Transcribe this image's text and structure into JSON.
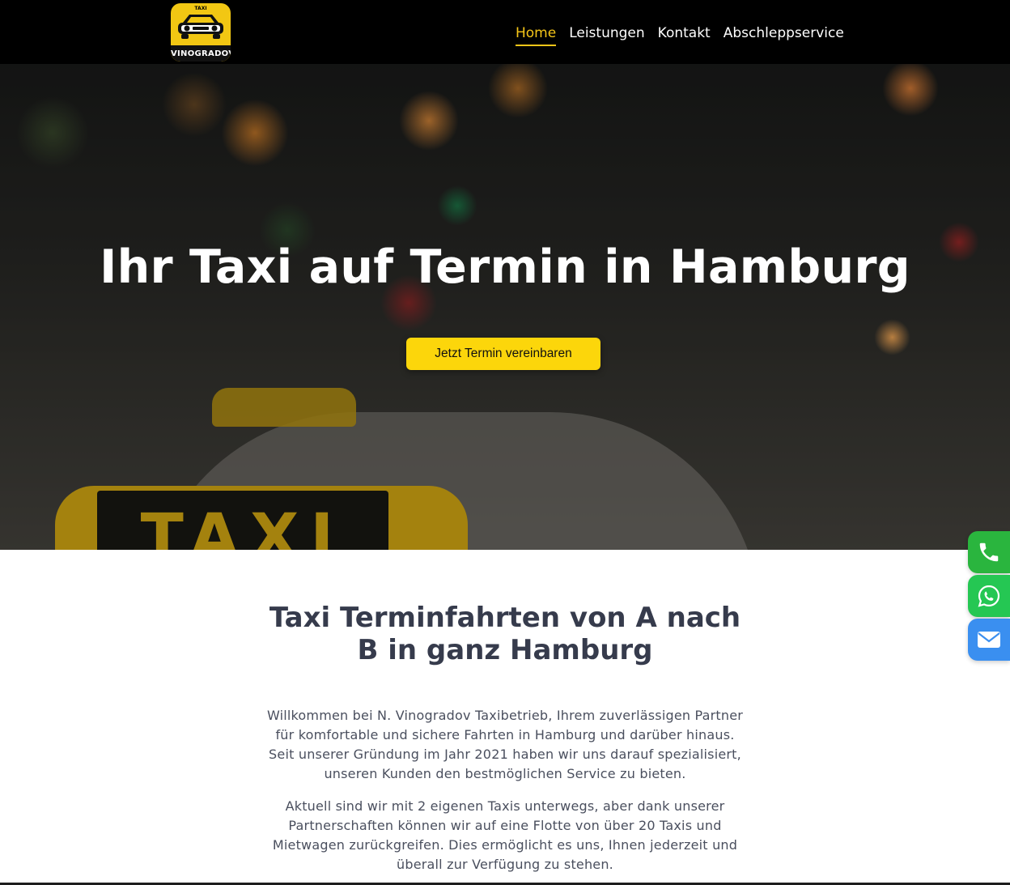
{
  "nav": {
    "logo": {
      "small_text": "TAXI",
      "name": "VINOGRADOV"
    },
    "links": [
      {
        "label": "Home",
        "active": true
      },
      {
        "label": "Leistungen",
        "active": false
      },
      {
        "label": "Kontakt",
        "active": false
      },
      {
        "label": "Abschleppservice",
        "active": false
      }
    ]
  },
  "hero": {
    "title": "Ihr Taxi auf Termin in Hamburg",
    "cta_label": "Jetzt Termin vereinbaren",
    "sign_text": "TAXI"
  },
  "intro": {
    "title": "Taxi Terminfahrten von A nach B in ganz Hamburg",
    "paragraphs": [
      "Willkommen bei N. Vinogradov Taxibetrieb, Ihrem zuverlässigen Partner für komfortable und sichere Fahrten in Hamburg und darüber hinaus. Seit unserer Gründung im Jahr 2021 haben wir uns darauf spezialisiert, unseren Kunden den bestmöglichen Service zu bieten.",
      "Aktuell sind wir mit 2 eigenen Taxis unterwegs, aber dank unserer Partnerschaften können wir auf eine Flotte von über 20 Taxis und Mietwagen zurückgreifen. Dies ermöglicht es uns, Ihnen jederzeit und überall zur Verfügung zu stehen."
    ]
  },
  "floating_buttons": [
    {
      "icon": "phone-icon",
      "color": "#2ab53e"
    },
    {
      "icon": "whatsapp-icon",
      "color": "#25c753"
    },
    {
      "icon": "mail-icon",
      "color": "#3a8ff0"
    }
  ],
  "colors": {
    "accent": "#f5c518",
    "cta": "#fcd60b",
    "heading": "#363b4c",
    "text": "#4a4f5e"
  }
}
